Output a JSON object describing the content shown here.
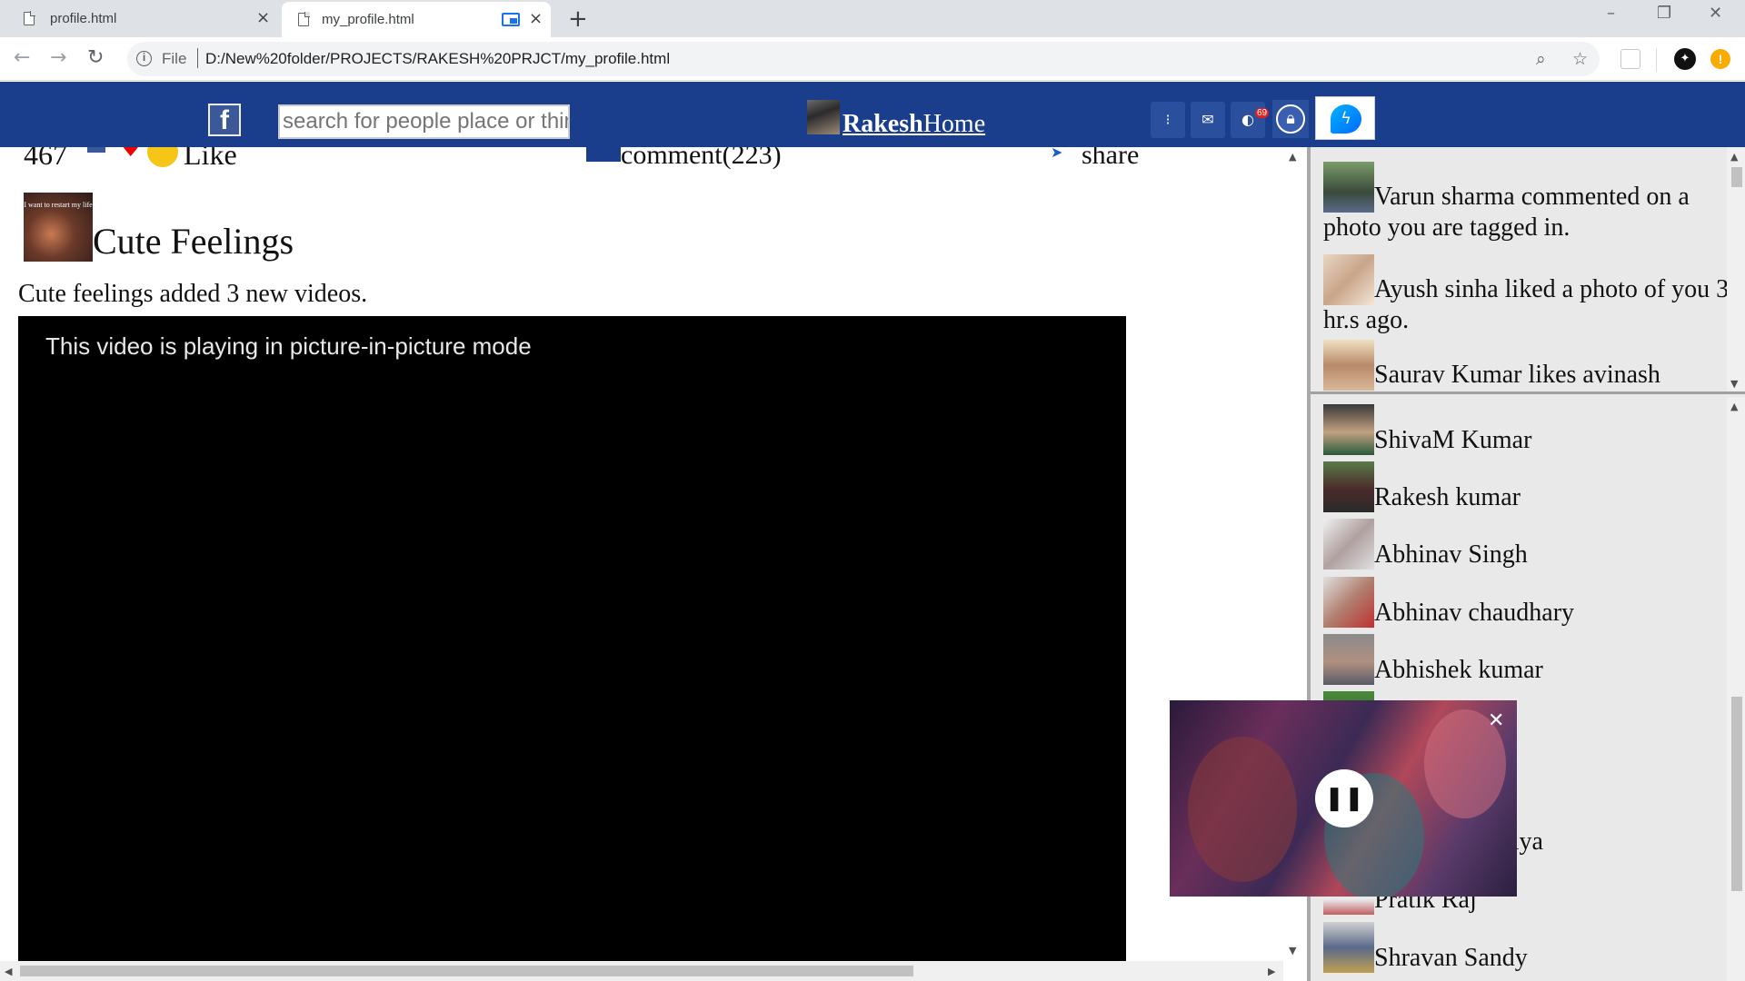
{
  "browser": {
    "tabs": [
      {
        "title": "profile.html",
        "active": false
      },
      {
        "title": "my_profile.html",
        "active": true
      }
    ],
    "omnibox": {
      "scheme_label": "File",
      "url": "D:/New%20folder/PROJECTS/RAKESH%20PRJCT/my_profile.html"
    }
  },
  "header": {
    "search_placeholder": "search for people place or things",
    "brand_part1": "Rakesh",
    "brand_part2": "Home",
    "notification_badge": "69",
    "colors": {
      "bar": "#1a3e8c"
    }
  },
  "post": {
    "like_count": "467",
    "like_label": "Like",
    "comment_label": "comment(223)",
    "share_label": "share",
    "thumb_caption": "I want to restart my life",
    "page_name": "Cute Feelings",
    "description": "Cute feelings added 3 new videos.",
    "pip_message": "This video is playing in picture-in-picture mode"
  },
  "notifications": [
    {
      "text": "Varun sharma commented on a photo you are tagged in."
    },
    {
      "text": "Ayush sinha liked a photo of you 3 hr.s ago."
    },
    {
      "text": "Saurav Kumar likes avinash"
    }
  ],
  "friends": [
    {
      "name": "ShivaM Kumar"
    },
    {
      "name": "Rakesh kumar"
    },
    {
      "name": "Abhinav Singh"
    },
    {
      "name": "Abhinav chaudhary"
    },
    {
      "name": "Abhishek kumar"
    },
    {
      "name": "ndilya"
    },
    {
      "name": "Pratik Raj"
    },
    {
      "name": "Shravan Sandy"
    }
  ]
}
